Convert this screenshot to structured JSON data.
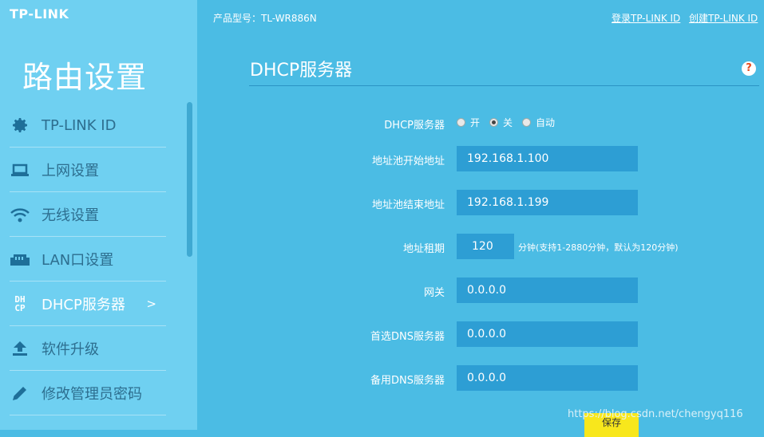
{
  "brand": {
    "logo": "TP-LINK"
  },
  "header": {
    "model_label": "产品型号：TL-WR886N",
    "login_link": "登录TP-LINK ID",
    "create_link": "创建TP-LINK ID"
  },
  "sidebar": {
    "title": "路由设置",
    "items": [
      {
        "label": "TP-LINK ID",
        "icon": "gear-icon"
      },
      {
        "label": "上网设置",
        "icon": "laptop-icon"
      },
      {
        "label": "无线设置",
        "icon": "wifi-icon"
      },
      {
        "label": "LAN口设置",
        "icon": "ethernet-port-icon"
      },
      {
        "label": "DHCP服务器",
        "icon": "dhcp-icon",
        "icon_text": "DH\nCP",
        "active": true,
        "arrow": ">"
      },
      {
        "label": "软件升级",
        "icon": "upload-icon"
      },
      {
        "label": "修改管理员密码",
        "icon": "pencil-icon"
      }
    ]
  },
  "main": {
    "title": "DHCP服务器",
    "help": "?",
    "dhcp_server": {
      "label": "DHCP服务器",
      "options": [
        "开",
        "关",
        "自动"
      ],
      "selected": "关"
    },
    "pool_start": {
      "label": "地址池开始地址",
      "value": "192.168.1.100"
    },
    "pool_end": {
      "label": "地址池结束地址",
      "value": "192.168.1.199"
    },
    "lease": {
      "label": "地址租期",
      "value": "120",
      "hint": "分钟(支持1-2880分钟，默认为120分钟)"
    },
    "gateway": {
      "label": "网关",
      "value": "0.0.0.0"
    },
    "primary_dns": {
      "label": "首选DNS服务器",
      "value": "0.0.0.0"
    },
    "secondary_dns": {
      "label": "备用DNS服务器",
      "value": "0.0.0.0"
    },
    "save_label": "保存"
  },
  "watermark": "https://blog.csdn.net/chengyq116",
  "colors": {
    "sidebar_bg": "#6fd0f1",
    "main_bg": "#4bbce4",
    "field_bg": "#2d9ed4",
    "save_bg": "#f8e71c"
  }
}
